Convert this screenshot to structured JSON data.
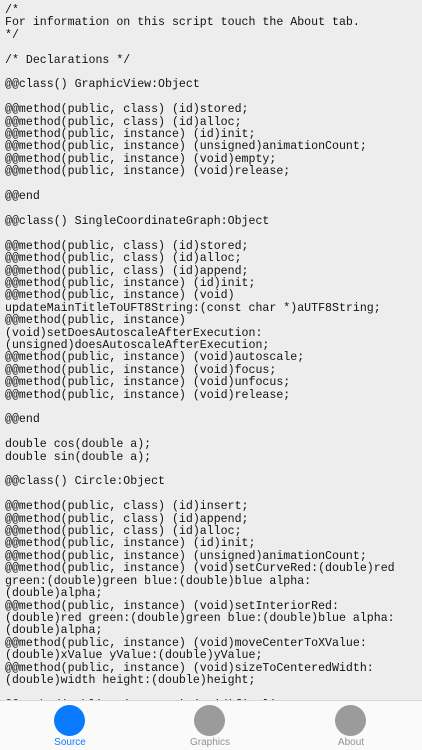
{
  "source": {
    "code": "/*\nFor information on this script touch the About tab.\n*/\n\n/* Declarations */\n\n@@class() GraphicView:Object\n\n@@method(public, class) (id)stored;\n@@method(public, class) (id)alloc;\n@@method(public, instance) (id)init;\n@@method(public, instance) (unsigned)animationCount;\n@@method(public, instance) (void)empty;\n@@method(public, instance) (void)release;\n\n@@end\n\n@@class() SingleCoordinateGraph:Object\n\n@@method(public, class) (id)stored;\n@@method(public, class) (id)alloc;\n@@method(public, class) (id)append;\n@@method(public, instance) (id)init;\n@@method(public, instance) (void)\nupdateMainTitleToUFT8String:(const char *)aUTF8String;\n@@method(public, instance)\n(void)setDoesAutoscaleAfterExecution:\n(unsigned)doesAutoscaleAfterExecution;\n@@method(public, instance) (void)autoscale;\n@@method(public, instance) (void)focus;\n@@method(public, instance) (void)unfocus;\n@@method(public, instance) (void)release;\n\n@@end\n\ndouble cos(double a);\ndouble sin(double a);\n\n@@class() Circle:Object\n\n@@method(public, class) (id)insert;\n@@method(public, class) (id)append;\n@@method(public, class) (id)alloc;\n@@method(public, instance) (id)init;\n@@method(public, instance) (unsigned)animationCount;\n@@method(public, instance) (void)setCurveRed:(double)red\ngreen:(double)green blue:(double)blue alpha:\n(double)alpha;\n@@method(public, instance) (void)setInteriorRed:\n(double)red green:(double)green blue:(double)blue alpha:\n(double)alpha;\n@@method(public, instance) (void)moveCenterToXValue:\n(double)xValue yValue:(double)yValue;\n@@method(public, instance) (void)sizeToCenteredWidth:\n(double)width height:(double)height;\n\n@@method(public, instance) (void)finalize;"
  },
  "tabs": [
    {
      "label": "Source",
      "selected": true,
      "icon": "source-circle-icon"
    },
    {
      "label": "Graphics",
      "selected": false,
      "icon": "graphics-circle-icon"
    },
    {
      "label": "About",
      "selected": false,
      "icon": "about-circle-icon"
    }
  ],
  "colors": {
    "selected_tab": "#0a7aff",
    "unselected_tab_icon": "#9b9b9b",
    "unselected_tab_label": "#929292",
    "code_background": "#ededed"
  }
}
